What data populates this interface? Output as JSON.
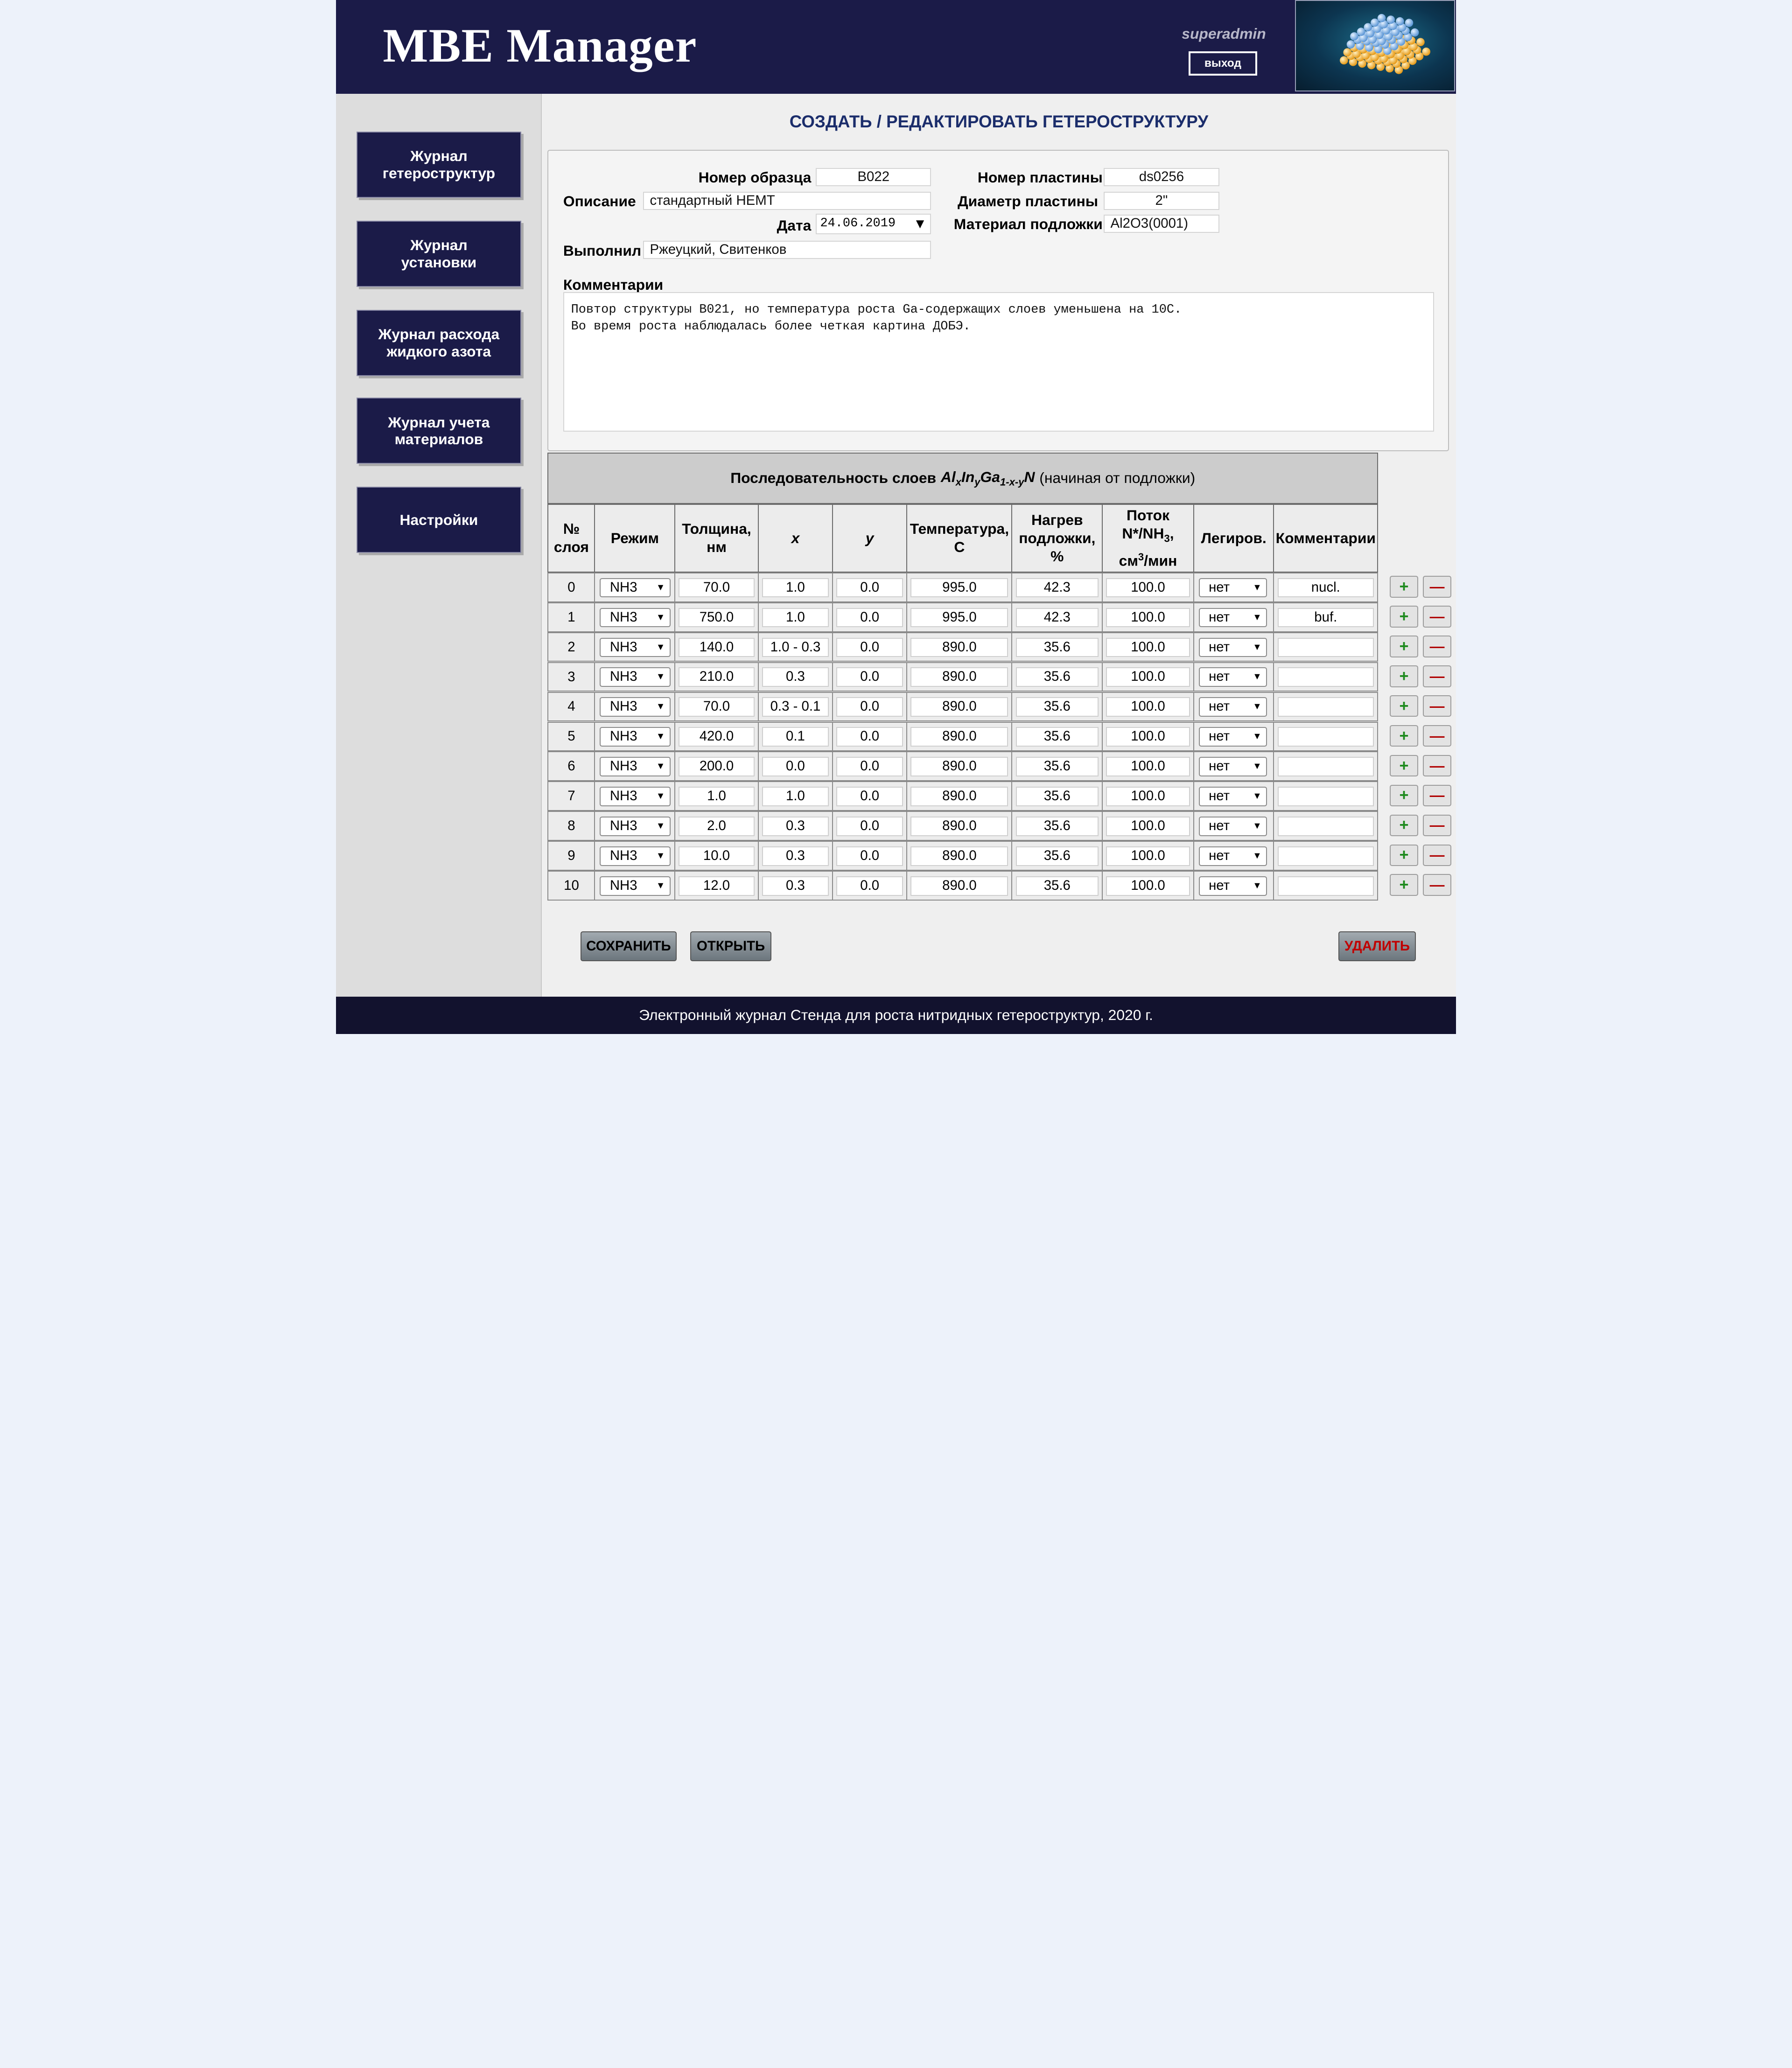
{
  "app": {
    "title": "MBE Manager",
    "user": "superadmin",
    "logout_label": "выход"
  },
  "sidebar": {
    "items": [
      {
        "label": "Журнал\nгетероструктур"
      },
      {
        "label": "Журнал\nустановки"
      },
      {
        "label": "Журнал расхода\nжидкого азота"
      },
      {
        "label": "Журнал учета\nматериалов"
      },
      {
        "label": "Настройки"
      }
    ]
  },
  "page": {
    "title": "СОЗДАТЬ / РЕДАКТИРОВАТЬ ГЕТЕРОСТРУКТУРУ"
  },
  "form": {
    "sample_number_label": "Номер образца",
    "sample_number": "B022",
    "description_label": "Описание",
    "description": "стандартный HEMT",
    "date_label": "Дата",
    "date": "24.06.2019",
    "performed_by_label": "Выполнил",
    "performed_by": "Ржеуцкий, Свитенков",
    "wafer_number_label": "Номер пластины",
    "wafer_number": "ds0256",
    "wafer_diameter_label": "Диаметр пластины",
    "wafer_diameter": "2\"",
    "substrate_material_label": "Материал подложки",
    "substrate_material": "Al2O3(0001)",
    "comments_label": "Комментарии",
    "comments": "Повтор структуры B021, но температура роста Ga-содержащих слоев уменьшена на 10C.\nВо время роста наблюдалась более четкая картина ДОБЭ."
  },
  "layers": {
    "caption_title": "Последовательность слоев",
    "caption_note": "(начиная от подложки)",
    "formula": {
      "al": "Al",
      "x": "x",
      "in": "In",
      "y": "y",
      "ga": "Ga",
      "sub": "1-x-y",
      "n": "N"
    },
    "columns": {
      "index": "№\nслоя",
      "mode": "Режим",
      "thickness": "Толщина,\nнм",
      "x": "x",
      "y": "y",
      "temperature": "Температура,\nC",
      "heating": "Нагрев\nподложки,\n%",
      "flux_line1": "Поток",
      "flux_line2a": "N*/NH",
      "flux_sub": "3",
      "flux_line2b": ",",
      "flux_line3a": "см",
      "flux_sup": "3",
      "flux_line3b": "/мин",
      "doping": "Легиров.",
      "comment": "Комментарии"
    },
    "rows": [
      {
        "index": "0",
        "mode": "NH3",
        "thickness": "70.0",
        "x": "1.0",
        "y": "0.0",
        "temperature": "995.0",
        "heating": "42.3",
        "flux": "100.0",
        "doping": "нет",
        "comment": "nucl."
      },
      {
        "index": "1",
        "mode": "NH3",
        "thickness": "750.0",
        "x": "1.0",
        "y": "0.0",
        "temperature": "995.0",
        "heating": "42.3",
        "flux": "100.0",
        "doping": "нет",
        "comment": "buf."
      },
      {
        "index": "2",
        "mode": "NH3",
        "thickness": "140.0",
        "x": "1.0 - 0.3",
        "y": "0.0",
        "temperature": "890.0",
        "heating": "35.6",
        "flux": "100.0",
        "doping": "нет",
        "comment": ""
      },
      {
        "index": "3",
        "mode": "NH3",
        "thickness": "210.0",
        "x": "0.3",
        "y": "0.0",
        "temperature": "890.0",
        "heating": "35.6",
        "flux": "100.0",
        "doping": "нет",
        "comment": ""
      },
      {
        "index": "4",
        "mode": "NH3",
        "thickness": "70.0",
        "x": "0.3 - 0.1",
        "y": "0.0",
        "temperature": "890.0",
        "heating": "35.6",
        "flux": "100.0",
        "doping": "нет",
        "comment": ""
      },
      {
        "index": "5",
        "mode": "NH3",
        "thickness": "420.0",
        "x": "0.1",
        "y": "0.0",
        "temperature": "890.0",
        "heating": "35.6",
        "flux": "100.0",
        "doping": "нет",
        "comment": ""
      },
      {
        "index": "6",
        "mode": "NH3",
        "thickness": "200.0",
        "x": "0.0",
        "y": "0.0",
        "temperature": "890.0",
        "heating": "35.6",
        "flux": "100.0",
        "doping": "нет",
        "comment": ""
      },
      {
        "index": "7",
        "mode": "NH3",
        "thickness": "1.0",
        "x": "1.0",
        "y": "0.0",
        "temperature": "890.0",
        "heating": "35.6",
        "flux": "100.0",
        "doping": "нет",
        "comment": ""
      },
      {
        "index": "8",
        "mode": "NH3",
        "thickness": "2.0",
        "x": "0.3",
        "y": "0.0",
        "temperature": "890.0",
        "heating": "35.6",
        "flux": "100.0",
        "doping": "нет",
        "comment": ""
      },
      {
        "index": "9",
        "mode": "NH3",
        "thickness": "10.0",
        "x": "0.3",
        "y": "0.0",
        "temperature": "890.0",
        "heating": "35.6",
        "flux": "100.0",
        "doping": "нет",
        "comment": ""
      },
      {
        "index": "10",
        "mode": "NH3",
        "thickness": "12.0",
        "x": "0.3",
        "y": "0.0",
        "temperature": "890.0",
        "heating": "35.6",
        "flux": "100.0",
        "doping": "нет",
        "comment": ""
      }
    ],
    "add_label": "+",
    "remove_label": "—"
  },
  "actions": {
    "save_label": "СОХРАНИТЬ",
    "open_label": "ОТКРЫТЬ",
    "delete_label": "УДАЛИТЬ"
  },
  "footer": {
    "text": "Электронный журнал Стенда для роста нитридных гетероструктур, 2020 г."
  },
  "colors": {
    "header_bg": "#1b1b48",
    "nav_button_bg": "#1b1b48",
    "title_color": "#1b2d6b",
    "add_color": "#1d8a1d",
    "remove_color": "#b00000",
    "delete_text": "#c00000"
  },
  "icons": {
    "logo": "crystal-lattice-logo",
    "dropdown": "triangle-down-icon",
    "add": "plus-icon",
    "remove": "minus-icon"
  }
}
